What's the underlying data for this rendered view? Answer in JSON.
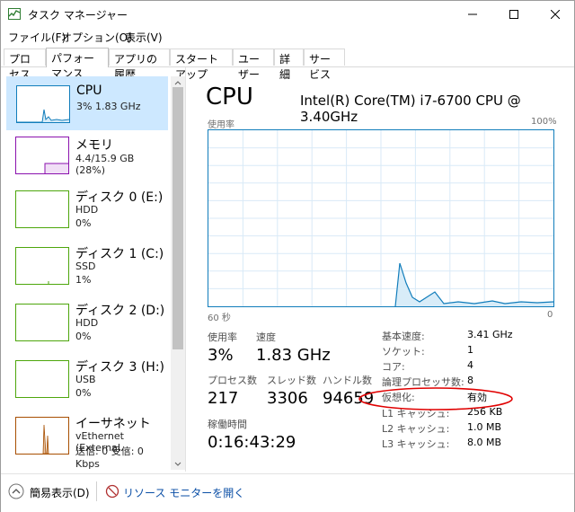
{
  "window": {
    "title": "タスク マネージャー"
  },
  "menu": [
    "ファイル(F)",
    "オプション(O)",
    "表示(V)"
  ],
  "tabs": [
    "プロセス",
    "パフォーマンス",
    "アプリの履歴",
    "スタートアップ",
    "ユーザー",
    "詳細",
    "サービス"
  ],
  "sidebar": {
    "items": [
      {
        "title": "CPU",
        "sub1": "3%  1.83 GHz",
        "sub2": ""
      },
      {
        "title": "メモリ",
        "sub1": "4.4/15.9 GB (28%)",
        "sub2": ""
      },
      {
        "title": "ディスク 0 (E:)",
        "sub1": "HDD",
        "sub2": "0%"
      },
      {
        "title": "ディスク 1 (C:)",
        "sub1": "SSD",
        "sub2": "1%"
      },
      {
        "title": "ディスク 2 (D:)",
        "sub1": "HDD",
        "sub2": "0%"
      },
      {
        "title": "ディスク 3 (H:)",
        "sub1": "USB",
        "sub2": "0%"
      },
      {
        "title": "イーサネット",
        "sub1": "vEthernet (External...",
        "sub2": "送信: 0 受信: 0 Kbps"
      }
    ]
  },
  "main": {
    "title": "CPU",
    "model": "Intel(R) Core(TM) i7-6700 CPU @ 3.40GHz",
    "graph_label": "使用率",
    "graph_max": "100%",
    "graph_time": "60 秒",
    "graph_min": "0",
    "stats": {
      "usage_label": "使用率",
      "usage_value": "3%",
      "speed_label": "速度",
      "speed_value": "1.83 GHz",
      "process_label": "プロセス数",
      "process_value": "217",
      "thread_label": "スレッド数",
      "thread_value": "3306",
      "handle_label": "ハンドル数",
      "handle_value": "94659",
      "uptime_label": "稼働時間",
      "uptime_value": "0:16:43:29"
    },
    "details": [
      {
        "label": "基本速度:",
        "value": "3.41 GHz"
      },
      {
        "label": "ソケット:",
        "value": "1"
      },
      {
        "label": "コア:",
        "value": "4"
      },
      {
        "label": "論理プロセッサ数:",
        "value": "8"
      },
      {
        "label": "仮想化:",
        "value": "有効"
      },
      {
        "label": "L1 キャッシュ:",
        "value": "256 KB"
      },
      {
        "label": "L2 キャッシュ:",
        "value": "1.0 MB"
      },
      {
        "label": "L3 キャッシュ:",
        "value": "8.0 MB"
      }
    ]
  },
  "bottom": {
    "fewer_details": "簡易表示(D)",
    "resource_monitor": "リソース モニターを開く"
  },
  "colors": {
    "cpu": "#117dbb",
    "memory": "#8b12ae",
    "disk": "#4da60c",
    "ethernet": "#a74f01",
    "highlight": "#e00000"
  }
}
